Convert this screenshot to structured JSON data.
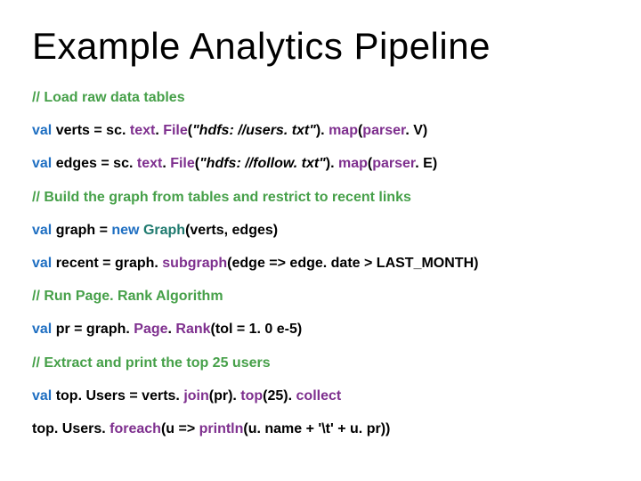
{
  "title": "Example Analytics Pipeline",
  "lines": {
    "c1": "// Load raw data tables",
    "l2": {
      "kw1": "val ",
      "v": "verts = sc. ",
      "fn1": "text",
      "t1": ". ",
      "fn2": "File",
      "t2": "(",
      "s": "\"hdfs: //users. txt\"",
      "t3": "). ",
      "fn3": "map",
      "t4": "(",
      "fn4": "parser",
      "t5": ". V)"
    },
    "l3": {
      "kw1": "val ",
      "v": "edges = sc. ",
      "fn1": "text",
      "t1": ". ",
      "fn2": "File",
      "t2": "(",
      "s": "\"hdfs: //follow. txt\"",
      "t3": "). ",
      "fn3": "map",
      "t4": "(",
      "fn4": "parser",
      "t5": ". E)"
    },
    "c4": "// Build the graph from tables and restrict to recent links",
    "l5": {
      "kw1": "val ",
      "v": "graph = ",
      "kw2": "new ",
      "typ": "Graph",
      "t": "(verts, edges)"
    },
    "l6": {
      "kw1": "val ",
      "v": "recent = graph. ",
      "fn1": "subgraph",
      "t1": "(edge => edge. date > LAST_MONTH)"
    },
    "c7": "// Run Page. Rank Algorithm",
    "l8": {
      "kw1": "val ",
      "v": "pr = graph. ",
      "fn1": "Page",
      "t1": ". ",
      "fn2": "Rank",
      "t2": "(tol = 1. 0 e-5)"
    },
    "c9": "// Extract and print the top 25 users",
    "l10": {
      "kw1": "val ",
      "v": "top. Users = verts. ",
      "fn1": "join",
      "t1": "(pr). ",
      "fn2": "top",
      "t2": "(25). ",
      "fn3": "collect"
    },
    "l11": {
      "v": "top. Users. ",
      "fn1": "foreach",
      "t1": "(u => ",
      "fn2": "println",
      "t2": "(u. name + '\\t' + u. pr))"
    }
  }
}
